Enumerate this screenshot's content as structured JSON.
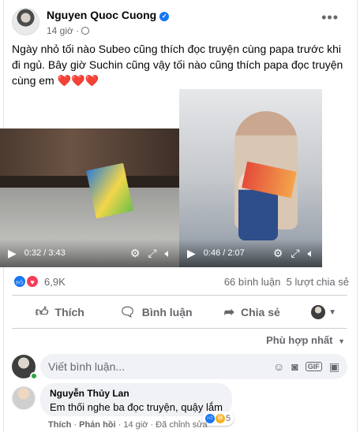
{
  "post": {
    "author": "Nguyen Quoc Cuong",
    "time": "14 giờ",
    "text": "Ngày nhỏ tối nào Subeo cũng thích đọc truyện cùng papa trước khi đi ngủ. Bây giờ Suchin cũng vậy tối nào cũng thích papa đọc truyện cùng em",
    "hearts": "❤️❤️❤️"
  },
  "videos": [
    {
      "time": "0:32 / 3:43"
    },
    {
      "time": "0:46 / 2:07"
    }
  ],
  "stats": {
    "reaction_count": "6,9K",
    "comments": "66 bình luận",
    "shares": "5 lượt chia sẻ"
  },
  "actions": {
    "like": "Thích",
    "comment": "Bình luận",
    "share": "Chia sẻ"
  },
  "comments": {
    "sort_label": "Phù hợp nhất",
    "input_placeholder": "Viết bình luận...",
    "first": {
      "author": "Nguyễn Thủy Lan",
      "text": "Em thối nghe ba đọc truyện, quậy lắm",
      "reaction_count": "5",
      "like": "Thích",
      "reply": "Phản hồi",
      "time": "14 giờ",
      "edited": "Đã chỉnh sửa"
    }
  },
  "colors": {
    "accent": "#1877f2",
    "love": "#f33e58",
    "muted_text": "#65676b"
  }
}
